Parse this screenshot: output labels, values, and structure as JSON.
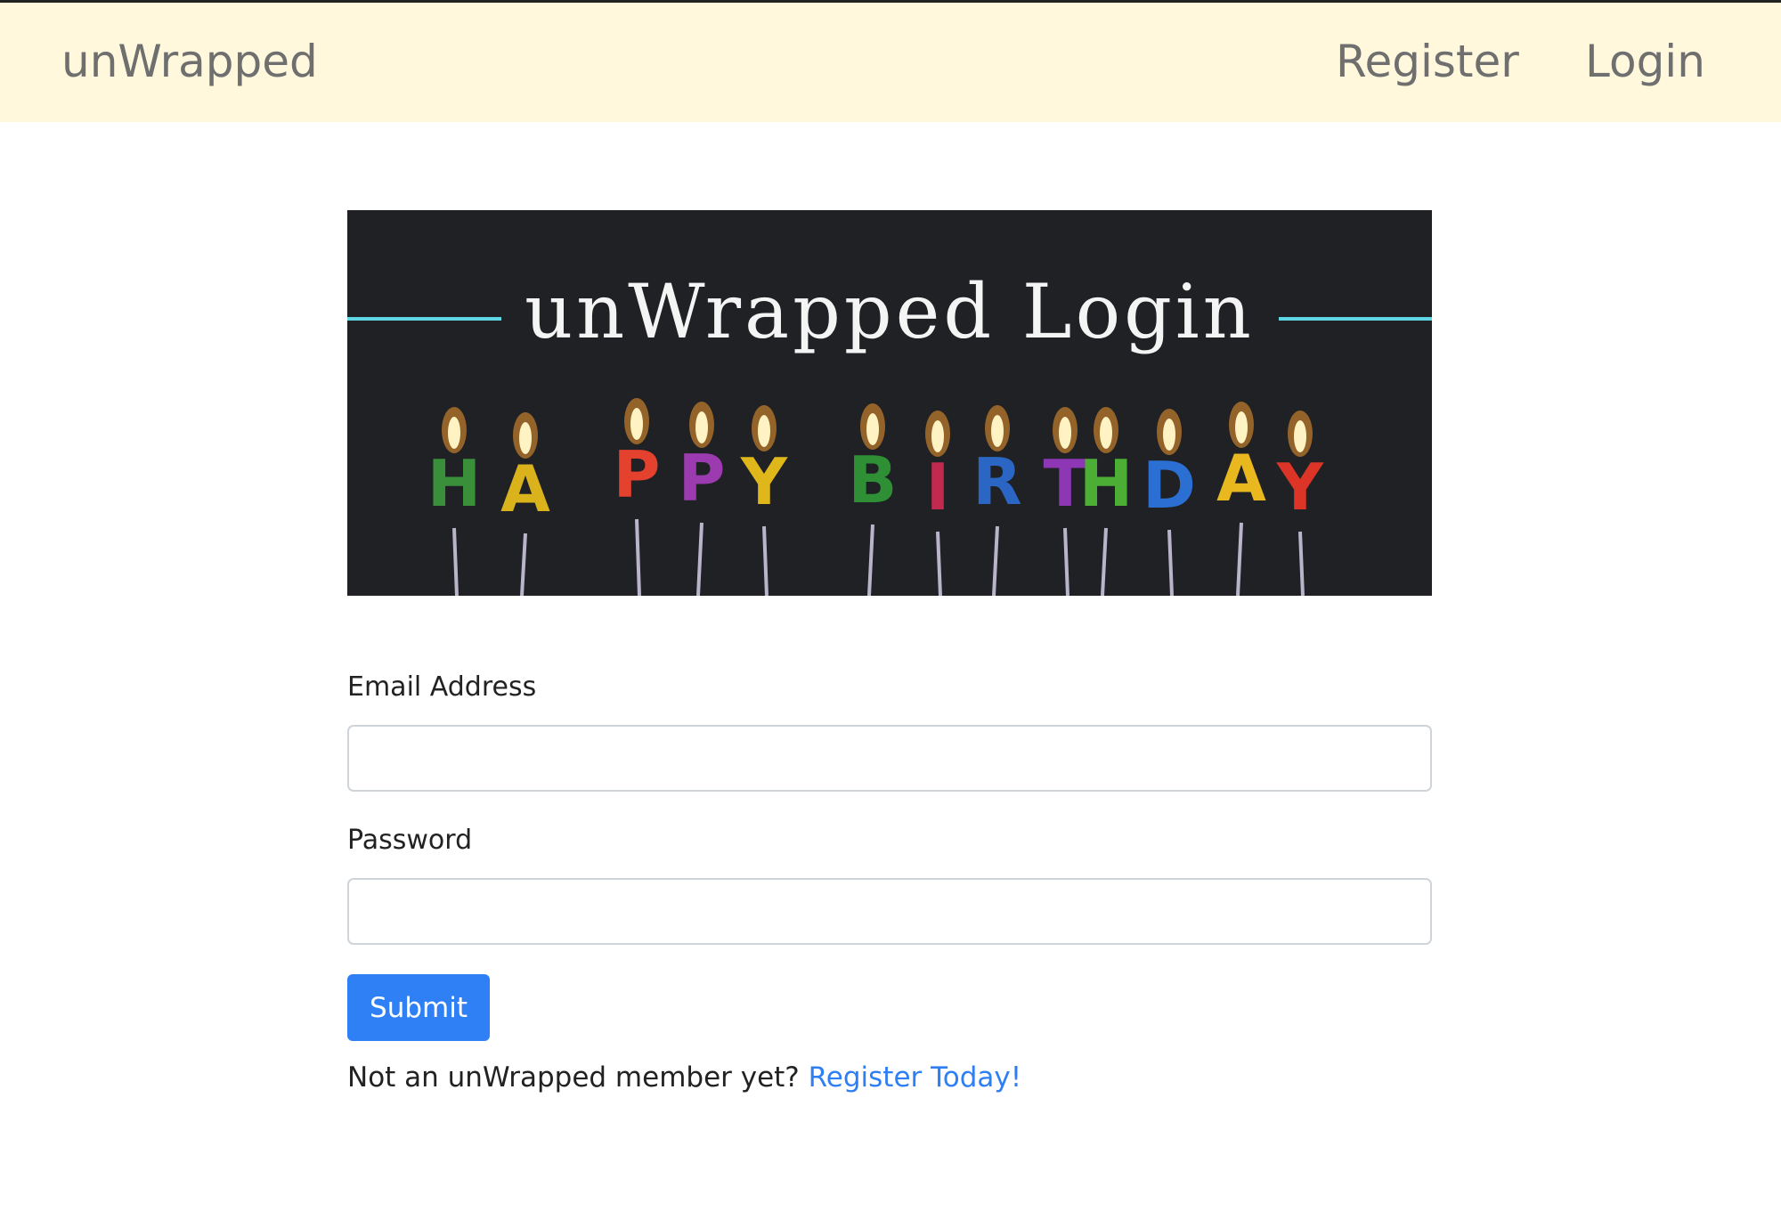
{
  "navbar": {
    "brand": "unWrapped",
    "links": [
      {
        "label": "Register"
      },
      {
        "label": "Login"
      }
    ]
  },
  "banner": {
    "title": "unWrapped Login",
    "candle_letters": [
      "H",
      "A",
      "P",
      "P",
      "Y",
      "B",
      "I",
      "R",
      "T",
      "H",
      "D",
      "A",
      "Y"
    ],
    "accent_color": "#5fd6e3"
  },
  "form": {
    "email_label": "Email Address",
    "email_value": "",
    "password_label": "Password",
    "password_value": "",
    "submit_label": "Submit"
  },
  "footer": {
    "prompt": "Not an unWrapped member yet?",
    "link_label": "Register Today!"
  },
  "colors": {
    "navbar_bg": "#fff8dc",
    "primary": "#3080f5",
    "link": "#2f7ff4"
  }
}
